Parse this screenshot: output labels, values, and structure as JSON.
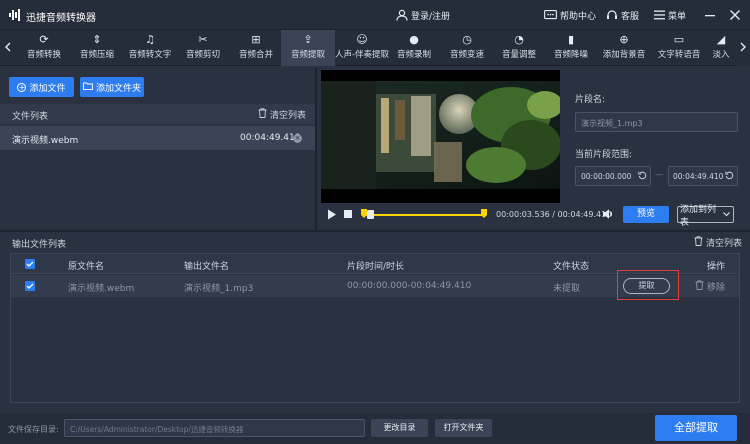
{
  "app": {
    "title": "迅捷音频转换器",
    "login": "登录/注册",
    "help": "帮助中心",
    "service": "客服",
    "menu": "菜单"
  },
  "toolbar": {
    "items": [
      "音频转换",
      "音频压缩",
      "音频转文字",
      "音频剪切",
      "音频合并",
      "音频提取",
      "人声-伴奏提取",
      "音频录制",
      "音频变速",
      "音量调整",
      "音频降噪",
      "添加背景音",
      "文字转语音",
      "淡入"
    ],
    "active": "音频提取"
  },
  "left": {
    "add_file": "添加文件",
    "add_folder": "添加文件夹",
    "file_list": "文件列表",
    "clear_list": "清空列表",
    "file_name": "演示视频.webm",
    "file_duration": "00:04:49.410"
  },
  "player": {
    "time_current": "00:00:03.536",
    "time_separator": "/",
    "time_total": "00:04:49.410",
    "preview": "预览",
    "add_to_list": "添加到列表"
  },
  "segment": {
    "name_label": "片段名:",
    "name_value": "演示视频_1.mp3",
    "range_label": "当前片段范围:",
    "start": "00:00:00.000",
    "dash": "—",
    "end": "00:04:49.410"
  },
  "output": {
    "title": "输出文件列表",
    "clear": "清空列表",
    "columns": [
      "原文件名",
      "输出文件名",
      "片段时间/时长",
      "文件状态",
      "操作"
    ],
    "rows": [
      {
        "source": "演示视频.webm",
        "output": "演示视频_1.mp3",
        "range": "00:00:00.000-00:04:49.410",
        "status": "未提取",
        "extract": "提取",
        "remove": "移除"
      }
    ]
  },
  "footer": {
    "save_label": "文件保存目录:",
    "save_path": "C:/Users/Administrator/Desktop/迅捷音频转换器",
    "change_dir": "更改目录",
    "open_folder": "打开文件夹",
    "extract_all": "全部提取"
  }
}
